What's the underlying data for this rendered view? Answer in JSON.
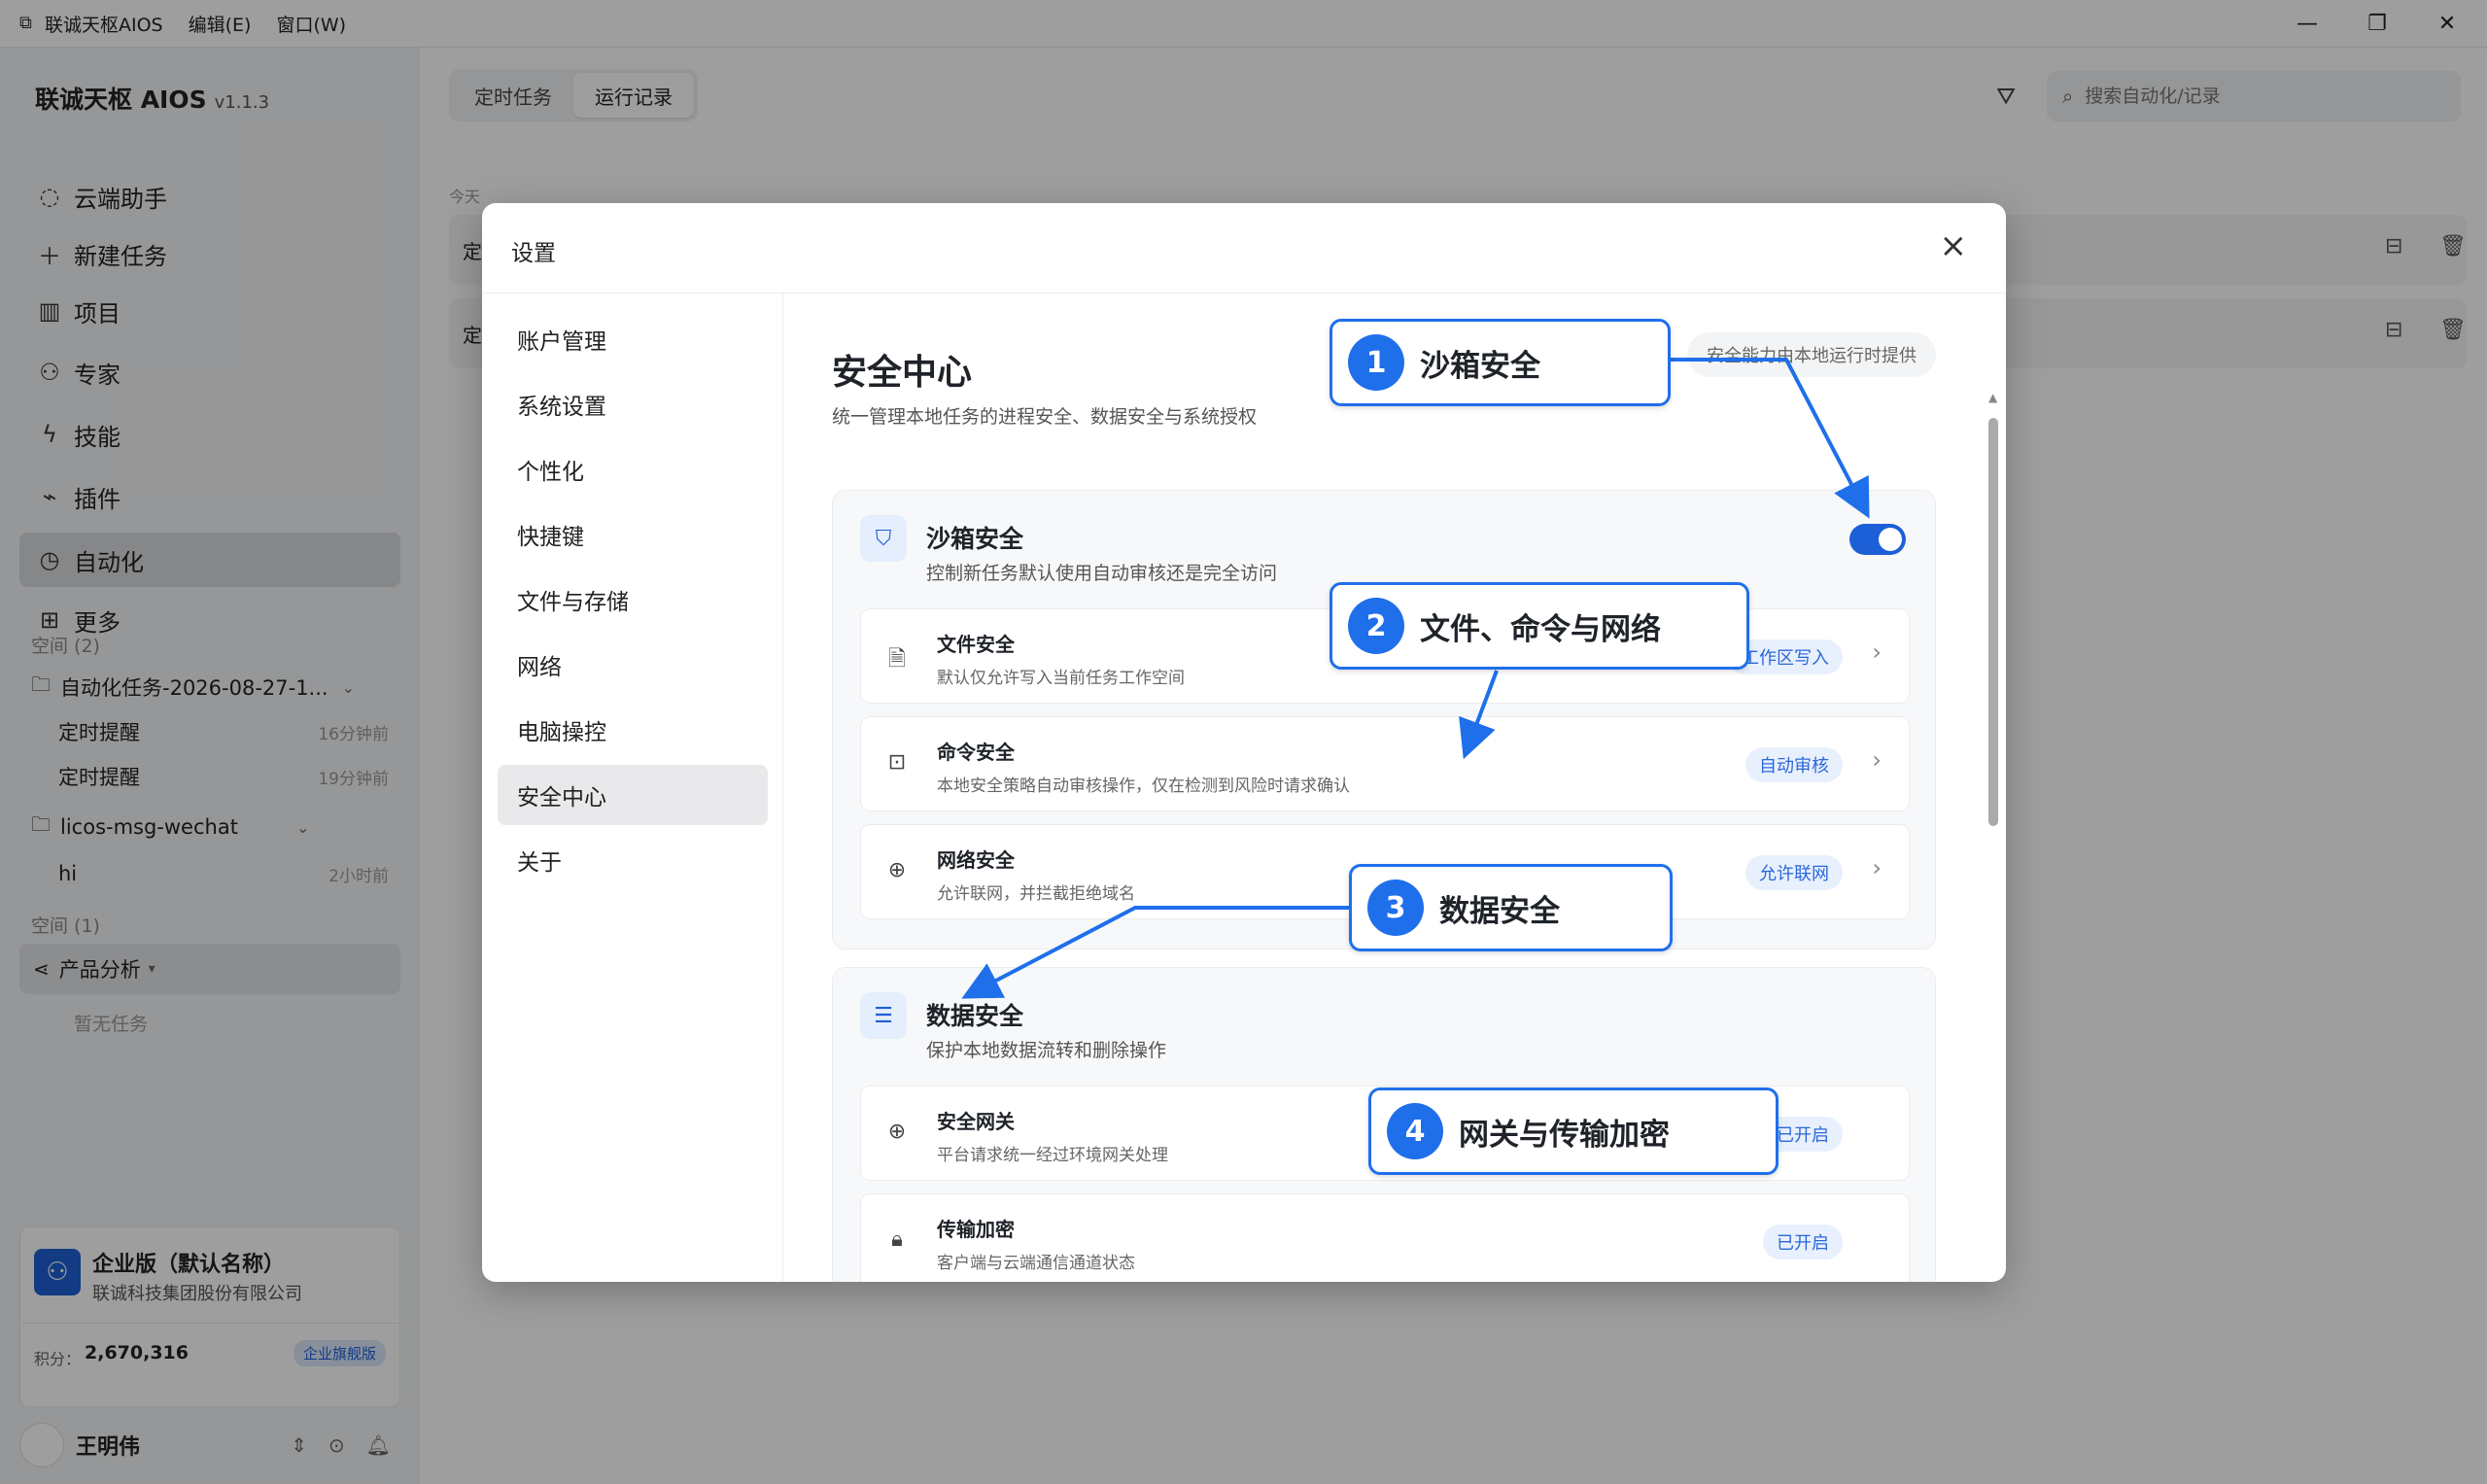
{
  "titlebar": {
    "app_name": "联诚天枢AIOS",
    "menus": [
      "编辑(E)",
      "窗口(W)"
    ]
  },
  "sidebar": {
    "brand": "联诚天枢 AIOS",
    "version": "v1.1.3",
    "nav": [
      {
        "label": "云端助手",
        "icon": "chat-icon"
      },
      {
        "label": "新建任务",
        "icon": "plus-icon"
      },
      {
        "label": "项目",
        "icon": "kanban-icon"
      },
      {
        "label": "专家",
        "icon": "people-icon"
      },
      {
        "label": "技能",
        "icon": "bolt-icon"
      },
      {
        "label": "插件",
        "icon": "plug-icon"
      },
      {
        "label": "自动化",
        "icon": "clock-icon"
      },
      {
        "label": "更多",
        "icon": "grid-icon"
      }
    ],
    "space1_label": "空间 (2)",
    "folder1": "自动化任务-2026-08-27-1...",
    "folder1_tasks": [
      {
        "name": "定时提醒",
        "time": "16分钟前"
      },
      {
        "name": "定时提醒",
        "time": "19分钟前"
      }
    ],
    "folder2": "licos-msg-wechat",
    "folder2_tasks": [
      {
        "name": "hi",
        "time": "2小时前"
      }
    ],
    "space2_label": "空间 (1)",
    "project": "产品分析",
    "empty_task": "暂无任务",
    "enterprise": {
      "name": "企业版（默认名称）",
      "company": "联诚科技集团股份有限公司",
      "points_label": "积分：",
      "points": "2,670,316",
      "badge": "企业旗舰版"
    },
    "user": "王明伟"
  },
  "main": {
    "tabs": [
      "定时任务",
      "运行记录"
    ],
    "search_placeholder": "搜索自动化/记录",
    "today_label": "今天",
    "row_prefix": "定"
  },
  "modal": {
    "title": "设置",
    "nav": [
      "账户管理",
      "系统设置",
      "个性化",
      "快捷键",
      "文件与存储",
      "网络",
      "电脑操控",
      "安全中心",
      "关于"
    ],
    "page_title": "安全中心",
    "page_sub": "统一管理本地任务的进程安全、数据安全与系统授权",
    "top_pill": "安全能力由本地运行时提供",
    "sandbox": {
      "title": "沙箱安全",
      "sub": "控制新任务默认使用自动审核还是完全访问",
      "items": [
        {
          "title": "文件安全",
          "sub": "默认仅允许写入当前任务工作空间",
          "badge": "工作区写入"
        },
        {
          "title": "命令安全",
          "sub": "本地安全策略自动审核操作，仅在检测到风险时请求确认",
          "badge": "自动审核"
        },
        {
          "title": "网络安全",
          "sub": "允许联网，并拦截拒绝域名",
          "badge": "允许联网"
        }
      ]
    },
    "data_security": {
      "title": "数据安全",
      "sub": "保护本地数据流转和删除操作",
      "items": [
        {
          "title": "安全网关",
          "sub": "平台请求统一经过环境网关处理",
          "badge": "已开启"
        },
        {
          "title": "传输加密",
          "sub": "客户端与云端通信通道状态",
          "badge": "已开启"
        }
      ]
    }
  },
  "callouts": [
    {
      "num": "1",
      "label": "沙箱安全"
    },
    {
      "num": "2",
      "label": "文件、命令与网络"
    },
    {
      "num": "3",
      "label": "数据安全"
    },
    {
      "num": "4",
      "label": "网关与传输加密"
    }
  ],
  "colors": {
    "accent": "#1f6feb",
    "brand": "#1d5fd6"
  }
}
